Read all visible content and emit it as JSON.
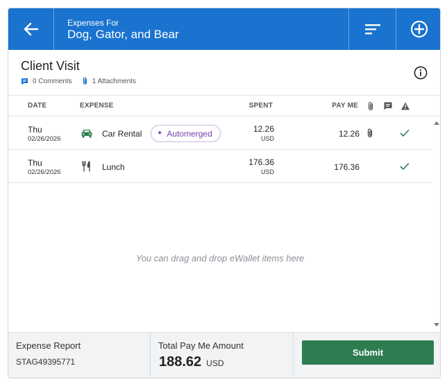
{
  "header": {
    "subtitle": "Expenses For",
    "title": "Dog, Gator, and Bear",
    "back_icon": "arrow-left-icon",
    "sort_icon": "sort-icon",
    "add_icon": "add-circle-icon"
  },
  "report": {
    "title": "Client Visit",
    "comments": "0 Comments",
    "attachments": "1 Attachments",
    "info_icon": "info-icon"
  },
  "table": {
    "headers": {
      "date": "DATE",
      "expense": "EXPENSE",
      "spent": "SPENT",
      "pay_me": "PAY ME"
    },
    "rows": [
      {
        "day": "Thu",
        "date": "02/26/2026",
        "category_icon": "car-icon",
        "expense": "Car Rental",
        "badge": "Automerged",
        "spent": "12.26",
        "spent_currency": "USD",
        "pay_me": "12.26",
        "has_attachment": true,
        "status_icon": "check-icon"
      },
      {
        "day": "Thu",
        "date": "02/26/2026",
        "category_icon": "utensils-icon",
        "expense": "Lunch",
        "badge": "",
        "spent": "176.36",
        "spent_currency": "USD",
        "pay_me": "176.36",
        "has_attachment": false,
        "status_icon": "check-icon"
      }
    ]
  },
  "dropzone_text": "You can drag and drop eWallet items here",
  "footer": {
    "report_label": "Expense Report",
    "report_id": "STAG49395771",
    "total_label": "Total Pay Me Amount",
    "total_amount": "188.62",
    "total_currency": "USD",
    "submit_label": "Submit"
  },
  "colors": {
    "header_bg": "#1a73cf",
    "submit_bg": "#2e7d50",
    "check": "#2e7d50",
    "badge_text": "#7a3fb0"
  }
}
